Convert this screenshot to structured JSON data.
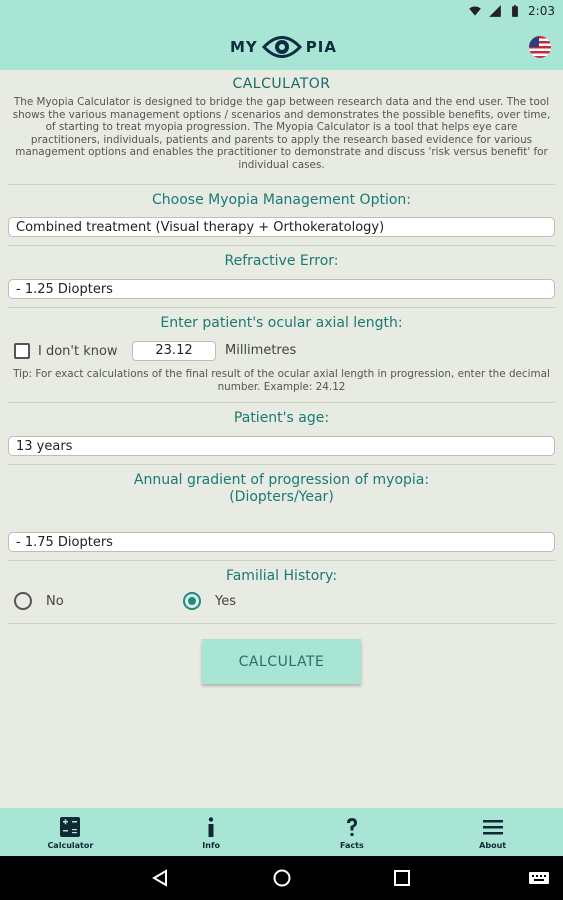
{
  "status_bar": {
    "time": "2:03"
  },
  "header": {
    "logo_left": "MY",
    "logo_right": "PIA"
  },
  "calculator": {
    "title": "CALCULATOR",
    "intro": "The Myopia Calculator is designed to bridge the gap between research data and the end user. The tool shows the various management options / scenarios and demonstrates the possible benefits, over time, of starting to treat myopia progression. The Myopia Calculator is a tool that helps eye care practitioners, individuals, patients and parents to apply the research based evidence for various management options and enables the practitioner to demonstrate and discuss 'risk versus benefit' for individual cases.",
    "management_label": "Choose Myopia Management Option:",
    "management_value": "Combined treatment (Visual therapy + Orthokeratology)",
    "refractive_label": "Refractive Error:",
    "refractive_value": "- 1.25 Diopters",
    "axial_label": "Enter patient's ocular axial length:",
    "dont_know_label": "I don't know",
    "axial_value": "23.12",
    "axial_unit": "Millimetres",
    "tip": "Tip: For exact calculations of the final result of the ocular axial length in progression, enter the decimal number. Example: 24.12",
    "age_label": "Patient's age:",
    "age_value": "13 years",
    "gradient_label_1": "Annual gradient of progression of myopia:",
    "gradient_label_2": "(Diopters/Year)",
    "gradient_value": "- 1.75 Diopters",
    "familial_label": "Familial History:",
    "familial_no": "No",
    "familial_yes": "Yes",
    "familial_selected": "Yes",
    "calculate_label": "CALCULATE"
  },
  "tabs": [
    {
      "label": "Calculator",
      "icon": "calculator-icon"
    },
    {
      "label": "Info",
      "icon": "info-icon"
    },
    {
      "label": "Facts",
      "icon": "question-icon"
    },
    {
      "label": "About",
      "icon": "menu-icon"
    }
  ],
  "colors": {
    "accent": "#a8e5d5",
    "background": "#e7ebe2",
    "label_teal": "#1a7a75",
    "radio_checked": "#1a8a85"
  }
}
